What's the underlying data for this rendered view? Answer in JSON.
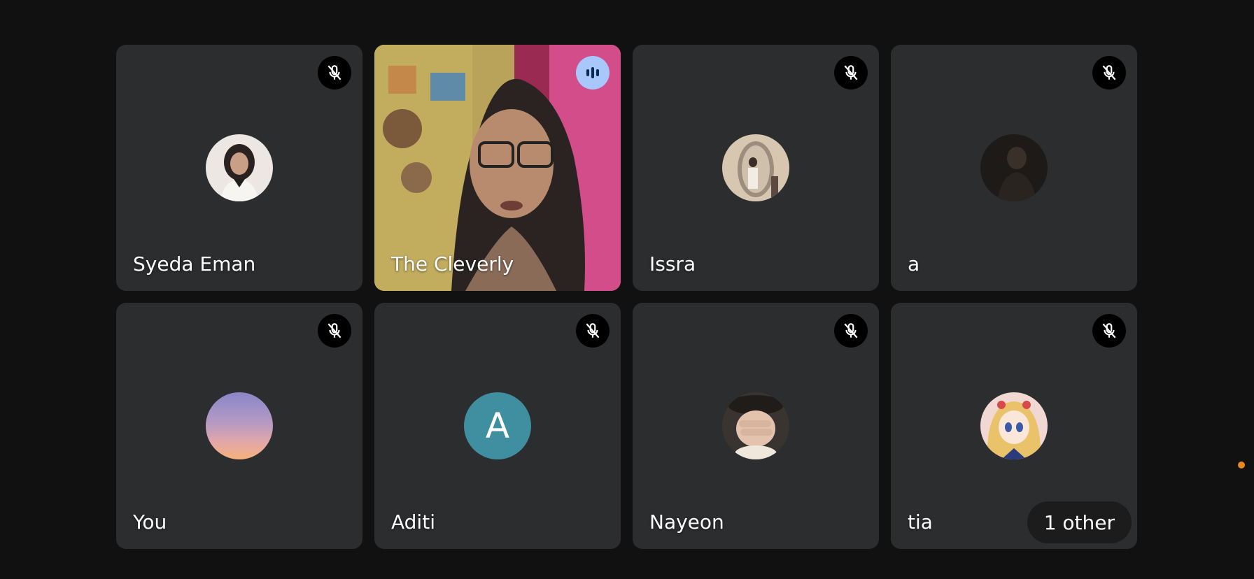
{
  "participants": [
    {
      "name": "Syeda Eman",
      "muted": true,
      "avatar_icon": "photo-avatar"
    },
    {
      "name": "The Cleverly",
      "muted": false,
      "speaking": true,
      "avatar_icon": "video-feed"
    },
    {
      "name": "Issra",
      "muted": true,
      "avatar_icon": "photo-avatar"
    },
    {
      "name": "a",
      "muted": true,
      "avatar_icon": "photo-avatar"
    },
    {
      "name": "You",
      "muted": true,
      "avatar_icon": "photo-avatar"
    },
    {
      "name": "Aditi",
      "muted": true,
      "avatar_icon": "letter-avatar",
      "initial": "A"
    },
    {
      "name": "Nayeon",
      "muted": true,
      "avatar_icon": "photo-avatar"
    },
    {
      "name": "tia",
      "muted": true,
      "avatar_icon": "photo-avatar"
    }
  ],
  "others_label": "1 other",
  "colors": {
    "background": "#111111",
    "tile": "#2c2d2f",
    "speaking_indicator": "#a8c7fa",
    "letter_avatar": "#3f8fa0",
    "status_dot": "#e8891e"
  }
}
